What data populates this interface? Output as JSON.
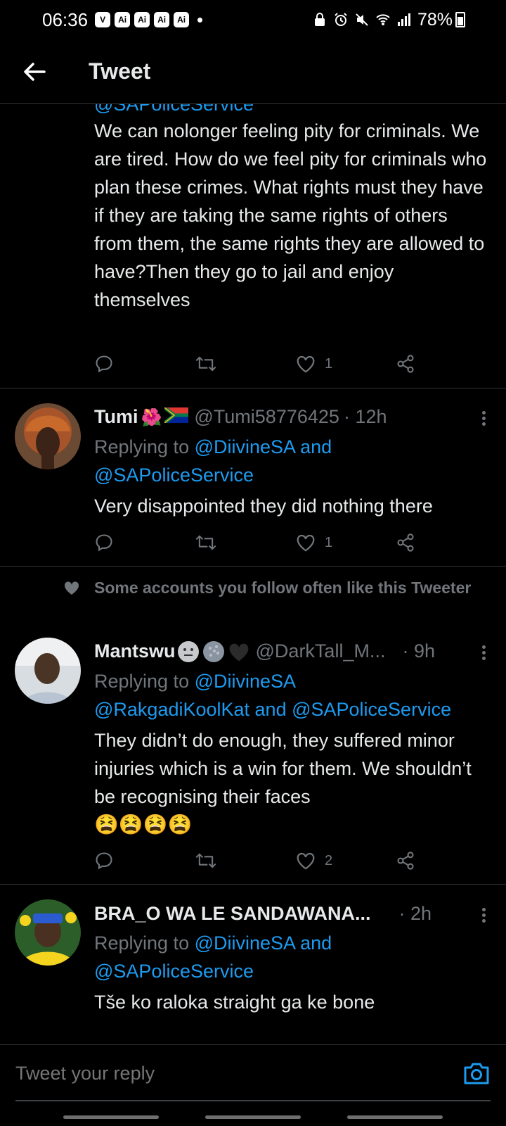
{
  "status_bar": {
    "time": "06:36",
    "badges": [
      "V",
      "Ai",
      "Ai",
      "Ai",
      "Ai"
    ],
    "battery": "78%"
  },
  "header": {
    "title": "Tweet"
  },
  "tweets": [
    {
      "clipped_handle": "@SAPoliceService",
      "text": "We can nolonger feeling pity for criminals. We are tired. How do we feel pity for criminals who plan these crimes. What rights must they have if they are taking the same rights of others from them, the same rights they are allowed to have?Then they go to jail and enjoy themselves",
      "likes": "1"
    },
    {
      "name": "Tumi",
      "handle": "@Tumi58776425",
      "time": "· 12h",
      "replying_label": "Replying to",
      "replying_to": "@DiivineSA and",
      "replying_to_2": "@SAPoliceService",
      "text": "Very disappointed they did nothing there",
      "likes": "1"
    },
    {
      "social_context": "Some accounts you follow often like this Tweeter",
      "name": "Mantswu",
      "handle": "@DarkTall_M...",
      "time": "· 9h",
      "replying_label": "Replying to",
      "replying_to": "@DiivineSA",
      "replying_to_2": "@RakgadiKoolKat and @SAPoliceService",
      "text": "They didn’t do enough, they suffered minor injuries which is a win for them. We shouldn’t be recognising their faces",
      "emojis": "😫😫😫😫",
      "likes": "2"
    },
    {
      "name": "BRA_O WA LE SANDAWANA...",
      "time": "· 2h",
      "replying_label": "Replying to",
      "replying_to": "@DiivineSA and",
      "replying_to_2": "@SAPoliceService",
      "text": "Tše ko raloka straight ga ke bone"
    }
  ],
  "reply_bar": {
    "placeholder": "Tweet your reply"
  },
  "colors": {
    "background": "#000000",
    "link": "#1d9bf0",
    "muted": "#71767b",
    "divider": "#2f3336"
  }
}
